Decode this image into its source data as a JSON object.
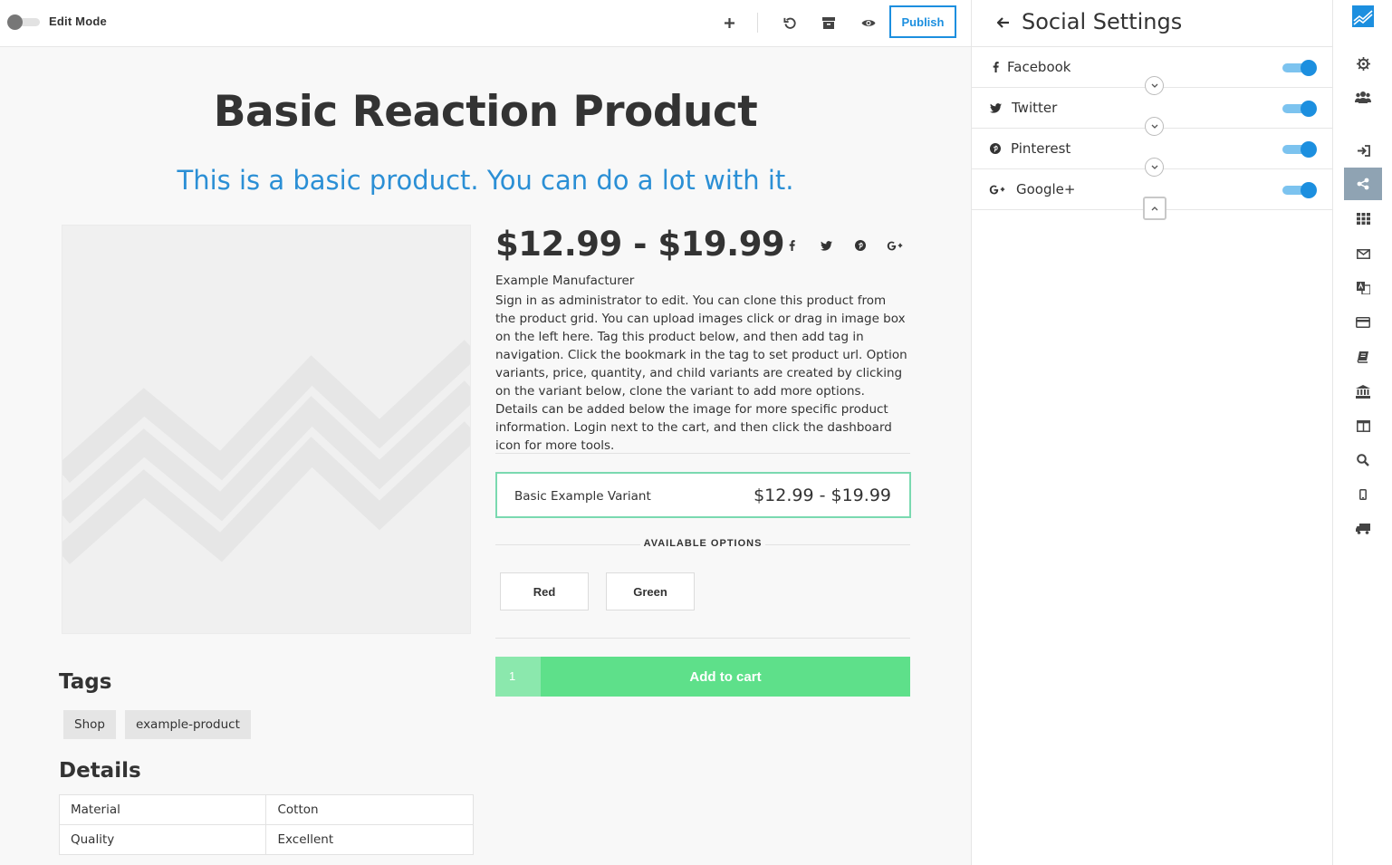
{
  "toolbar": {
    "edit_mode_label": "Edit Mode",
    "publish_label": "Publish",
    "icons": [
      "plus-icon",
      "undo-icon",
      "archive-icon",
      "eye-icon"
    ]
  },
  "product": {
    "title": "Basic Reaction Product",
    "subtitle": "This is a basic product. You can do a lot with it.",
    "price": "$12.99 - $19.99",
    "manufacturer": "Example Manufacturer",
    "description": "Sign in as administrator to edit. You can clone this product from the product grid. You can upload images click or drag in image box on the left here. Tag this product below, and then add tag in navigation. Click the bookmark in the tag to set product url. Option variants, price, quantity, and child variants are created by clicking on the variant below, clone the variant to add more options. Details can be added below the image for more specific product information. Login next to the cart, and then click the dashboard icon for more tools.",
    "share_icons": [
      "facebook-icon",
      "twitter-icon",
      "pinterest-icon",
      "google-plus-icon"
    ],
    "variant": {
      "name": "Basic Example Variant",
      "price": "$12.99 - $19.99"
    },
    "options_title": "AVAILABLE OPTIONS",
    "options": [
      "Red",
      "Green"
    ],
    "quantity": "1",
    "add_to_cart_label": "Add to cart",
    "tags_title": "Tags",
    "tags": [
      "Shop",
      "example-product"
    ],
    "details_title": "Details",
    "details": [
      {
        "key": "Material",
        "value": "Cotton"
      },
      {
        "key": "Quality",
        "value": "Excellent"
      }
    ]
  },
  "panel": {
    "title": "Social Settings",
    "items": [
      {
        "label": "Facebook",
        "icon": "facebook-icon",
        "enabled": true
      },
      {
        "label": "Twitter",
        "icon": "twitter-icon",
        "enabled": true
      },
      {
        "label": "Pinterest",
        "icon": "pinterest-icon",
        "enabled": true
      },
      {
        "label": "Google+",
        "icon": "google-plus-icon",
        "enabled": true
      }
    ]
  },
  "rail": {
    "icons": [
      "logo-icon",
      "gear-icon",
      "users-icon",
      "sign-in-icon",
      "share-icon",
      "grid-icon",
      "envelope-icon",
      "translate-icon",
      "credit-card-icon",
      "book-icon",
      "bank-icon",
      "columns-icon",
      "search-icon",
      "mobile-icon",
      "truck-icon"
    ],
    "active": "share-icon"
  },
  "colors": {
    "accent": "#1c8fdf",
    "subtitle": "#2b8fd5",
    "cart_green": "#5ee08a",
    "variant_border": "#7ad9b0"
  }
}
